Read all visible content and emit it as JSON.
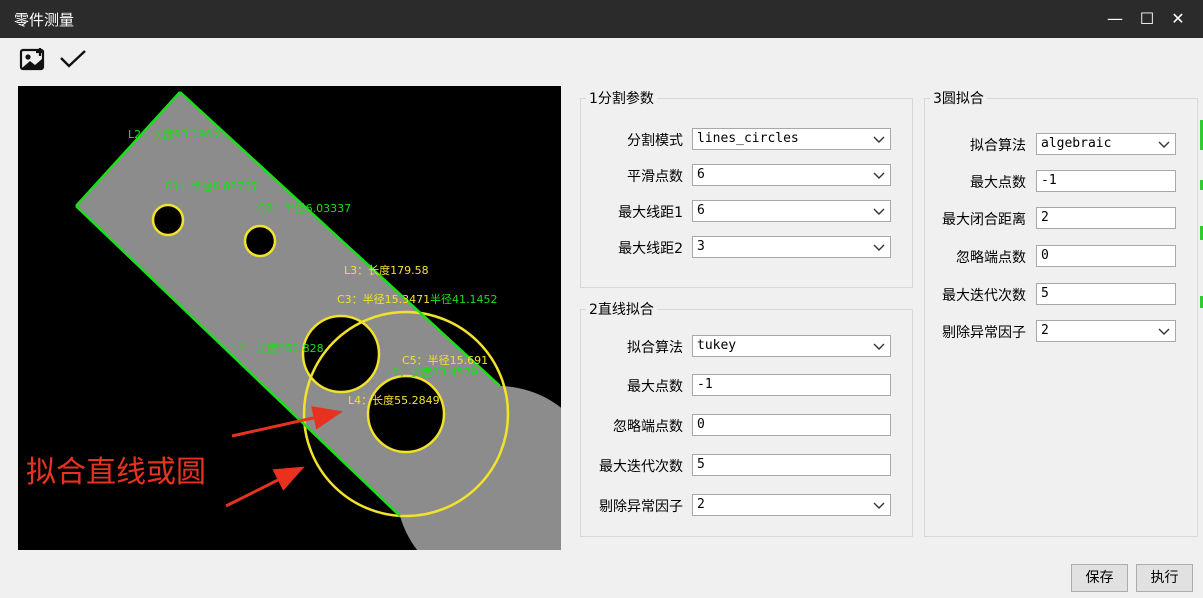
{
  "window": {
    "title": "零件测量",
    "minimize": "—",
    "maximize": "☐",
    "close": "✕"
  },
  "toolbar": {
    "open_image_icon": "image-plus-icon",
    "confirm_icon": "checkmark-icon"
  },
  "viewer": {
    "annotations": {
      "l2": "L2：长度93.1983",
      "c1": "C1：半径8.08737",
      "c2": "C2：半径6.03337",
      "l3": "L3：长度179.58",
      "c3": "C3：半径15.3471",
      "c4": "半径41.1452",
      "l1": "L1：长度150.828",
      "c5": "C5：半径15.691",
      "l5": "L5：长度33.4579",
      "l4": "L4：长度55.2849",
      "overlay": "拟合直线或圆"
    },
    "colors": {
      "part": "#8c8c8c",
      "line": "#19e019",
      "circle": "#f2e32a",
      "arrow": "#e8321f"
    }
  },
  "segmentation": {
    "title": "1分割参数",
    "rows": [
      {
        "label": "分割模式",
        "value": "lines_circles"
      },
      {
        "label": "平滑点数",
        "value": "6"
      },
      {
        "label": "最大线距1",
        "value": "6"
      },
      {
        "label": "最大线距2",
        "value": "3"
      }
    ]
  },
  "line_fit": {
    "title": "2直线拟合",
    "algorithm": {
      "label": "拟合算法",
      "value": "tukey"
    },
    "max_points": {
      "label": "最大点数",
      "value": "-1"
    },
    "ignore_end_points": {
      "label": "忽略端点数",
      "value": "0"
    },
    "max_iterations": {
      "label": "最大迭代次数",
      "value": "5"
    },
    "clipping_factor": {
      "label": "剔除异常因子",
      "value": "2"
    }
  },
  "circle_fit": {
    "title": "3圆拟合",
    "algorithm": {
      "label": "拟合算法",
      "value": "algebraic"
    },
    "max_points": {
      "label": "最大点数",
      "value": "-1"
    },
    "max_closure_distance": {
      "label": "最大闭合距离",
      "value": "2"
    },
    "ignore_end_points": {
      "label": "忽略端点数",
      "value": "0"
    },
    "max_iterations": {
      "label": "最大迭代次数",
      "value": "5"
    },
    "clipping_factor": {
      "label": "剔除异常因子",
      "value": "2"
    }
  },
  "actions": {
    "save": "保存",
    "run": "执行"
  }
}
